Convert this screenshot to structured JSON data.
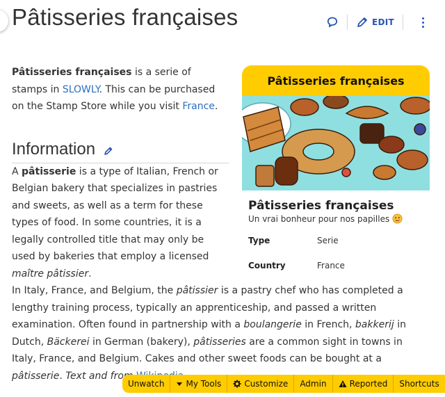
{
  "page": {
    "title": "Pâtisseries françaises"
  },
  "actions": {
    "edit_label": "EDIT"
  },
  "intro": {
    "bold": "Pâtisseries françaises",
    "t1": " is a serie of stamps in ",
    "link1": "SLOWLY",
    "t2": ". This can be purchased on the Stamp Store while you visit ",
    "link2": "France",
    "t3": "."
  },
  "section": {
    "heading": "Information"
  },
  "para1": {
    "t1": "A ",
    "b1": "pâtisserie",
    "t2": " is a type of Italian, French or Belgian bakery that specializes in pastries and sweets, as well as a term for these types of food. In some countries, it is a legally controlled title that may only be used by bakeries that employ a licensed ",
    "i1": "maître pâtissier",
    "t3": "."
  },
  "para2": {
    "t1": "In Italy, France, and Belgium, the ",
    "i1": "pâtissier",
    "t2": " is a pastry chef who has completed a lengthy training process, typically an apprenticeship, and passed a written examination. Often found in partnership with a ",
    "i2": "boulangerie",
    "t3": " in French, ",
    "i3": "bakkerij",
    "t4": " in Dutch, ",
    "i4": "Bäckerei",
    "t5": " in German (bakery), ",
    "i5": "pâtisseries",
    "t6": " are a common sight in towns in Italy, France, and Belgium. Cakes and other sweet foods can be bought at a ",
    "i6": "pâtisserie",
    "t7": ". ",
    "i7": "Text and from ",
    "link": "Wikipedia",
    "t8": "."
  },
  "infobox": {
    "header": "Pâtisseries françaises",
    "title": "Pâtisseries françaises",
    "subtitle": "Un vrai bonheur pour nos papilles",
    "rows": [
      {
        "key": "Type",
        "value": "Serie"
      },
      {
        "key": "Country",
        "value": "France"
      }
    ]
  },
  "toolbar": {
    "items": [
      "Unwatch",
      "My Tools",
      "Customize",
      "Admin",
      "Reported",
      "Shortcuts"
    ]
  },
  "colors": {
    "accent": "#ffcc00",
    "link": "#2a6ec0",
    "icon": "#2a55b5",
    "image_bg": "#8fdfe0"
  }
}
